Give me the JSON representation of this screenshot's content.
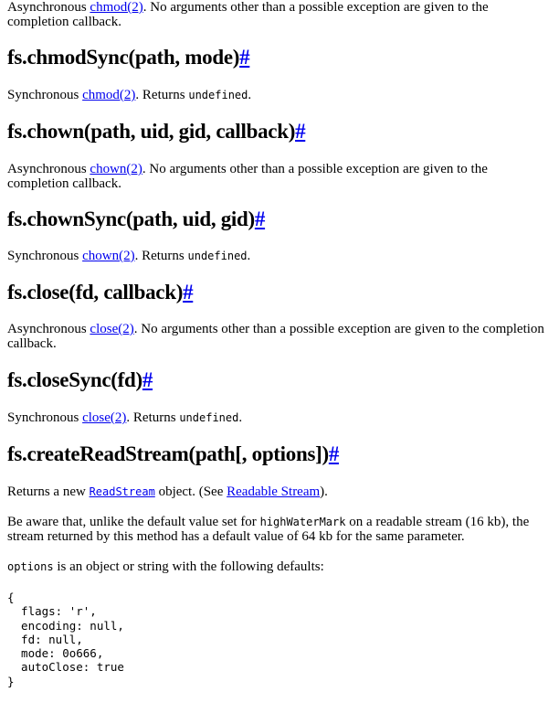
{
  "intro": {
    "prefix": "Asynchronous ",
    "link": "chmod(2)",
    "suffix": ". No arguments other than a possible exception are given to the completion callback."
  },
  "sections": {
    "chmodSync": {
      "heading": "fs.chmodSync(path, mode)",
      "anchor": "#",
      "text_prefix": "Synchronous ",
      "link": "chmod(2)",
      "text_mid": ". Returns ",
      "code": "undefined",
      "text_suffix": "."
    },
    "chown": {
      "heading": "fs.chown(path, uid, gid, callback)",
      "anchor": "#",
      "text_prefix": "Asynchronous ",
      "link": "chown(2)",
      "text_suffix": ". No arguments other than a possible exception are given to the completion callback."
    },
    "chownSync": {
      "heading": "fs.chownSync(path, uid, gid)",
      "anchor": "#",
      "text_prefix": "Synchronous ",
      "link": "chown(2)",
      "text_mid": ". Returns ",
      "code": "undefined",
      "text_suffix": "."
    },
    "close": {
      "heading": "fs.close(fd, callback)",
      "anchor": "#",
      "text_prefix": "Asynchronous ",
      "link": "close(2)",
      "text_suffix": ". No arguments other than a possible exception are given to the completion callback."
    },
    "closeSync": {
      "heading": "fs.closeSync(fd)",
      "anchor": "#",
      "text_prefix": "Synchronous ",
      "link": "close(2)",
      "text_mid": ". Returns ",
      "code": "undefined",
      "text_suffix": "."
    },
    "createReadStream": {
      "heading": "fs.createReadStream(path[, options])",
      "anchor": "#",
      "returns_prefix": "Returns a new ",
      "returns_code_link": "ReadStream",
      "returns_mid": " object. (See ",
      "returns_link": "Readable Stream",
      "returns_suffix": ").",
      "aware_prefix": "Be aware that, unlike the default value set for ",
      "aware_code": "highWaterMark",
      "aware_suffix": " on a readable stream (16 kb), the stream returned by this method has a default value of 64 kb for the same parameter.",
      "options_code": "options",
      "options_suffix": " is an object or string with the following defaults:",
      "defaults_block": "{\n  flags: 'r',\n  encoding: null,\n  fd: null,\n  mode: 0o666,\n  autoClose: true\n}"
    }
  }
}
